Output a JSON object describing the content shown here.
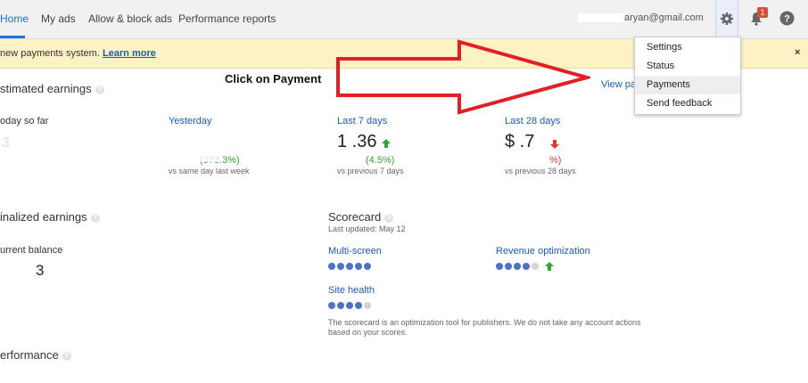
{
  "nav": {
    "tabs": [
      {
        "label": "Home"
      },
      {
        "label": "My ads"
      },
      {
        "label": "Allow & block ads"
      },
      {
        "label": "Performance reports"
      }
    ],
    "account_email": "aryan@gmail.com",
    "notification_count": "1"
  },
  "banner": {
    "text": "new payments system.",
    "link": "Learn more",
    "close": "×"
  },
  "settings_menu": {
    "items": [
      "Settings",
      "Status",
      "Payments",
      "Send feedback"
    ],
    "highlighted": "Payments"
  },
  "annotation": {
    "text": "Click on Payment",
    "arrow_color": "#e21f26"
  },
  "estimated_earnings": {
    "title": "stimated earnings",
    "view_link": "View pa",
    "today_label": "oday so far",
    "today_value": "3",
    "yesterday": {
      "label": "Yesterday",
      "change": "(373.3%)",
      "compare": "vs same day last week"
    },
    "last7": {
      "label": "Last 7 days",
      "value": "1  .36",
      "change": "(4.5%)",
      "compare": "vs previous 7 days"
    },
    "last28": {
      "label": "Last 28 days",
      "value": "$   .7",
      "change": "%)",
      "compare": "vs previous 28 days"
    }
  },
  "finalized_earnings": {
    "title": "inalized earnings",
    "balance_label": "urrent balance",
    "balance_value": "3"
  },
  "scorecard": {
    "title": "Scorecard",
    "updated": "Last updated: May 12",
    "multi_screen": {
      "label": "Multi-screen",
      "score": 5,
      "max": 5
    },
    "revenue_optimization": {
      "label": "Revenue optimization",
      "score": 4,
      "max": 5
    },
    "site_health": {
      "label": "Site health",
      "score": 4,
      "max": 5
    },
    "note": "The scorecard is an optimization tool for publishers. We do not take any account actions based on your scores."
  },
  "performance": {
    "title": "erformance"
  },
  "colors": {
    "accent": "#1a73e8",
    "link": "#1a5ab8",
    "up": "#33a532",
    "down": "#dd3b2b",
    "banner": "#fdf2c5"
  }
}
